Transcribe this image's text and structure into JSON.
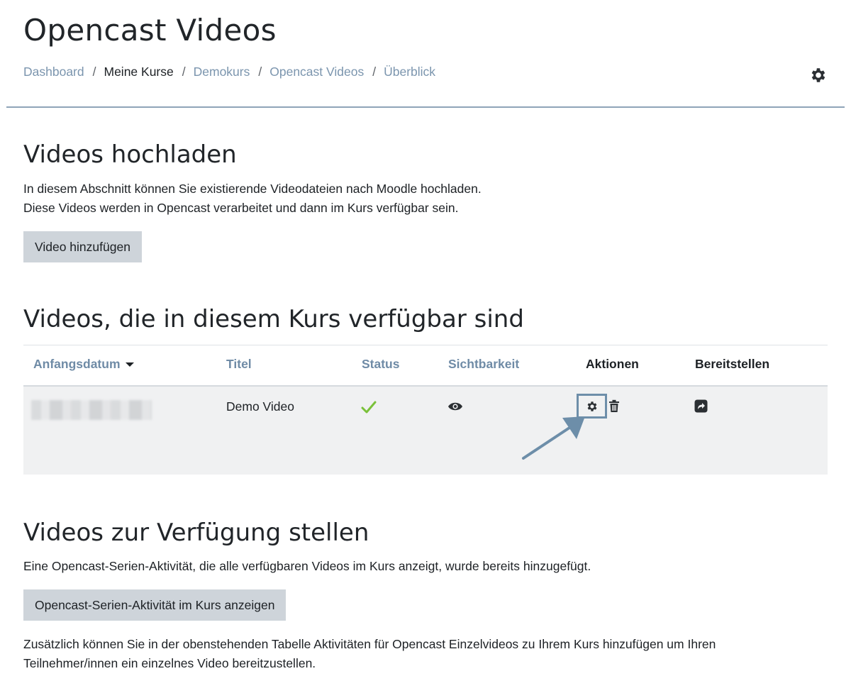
{
  "page": {
    "title": "Opencast Videos"
  },
  "breadcrumb": {
    "items": [
      "Dashboard",
      "Meine Kurse",
      "Demokurs",
      "Opencast Videos",
      "Überblick"
    ],
    "separator": "/"
  },
  "upload_section": {
    "heading": "Videos hochladen",
    "description_line1": "In diesem Abschnitt können Sie existierende Videodateien nach Moodle hochladen.",
    "description_line2": "Diese Videos werden in Opencast verarbeitet und dann im Kurs verfügbar sein.",
    "add_button": "Video hinzufügen"
  },
  "videos_section": {
    "heading": "Videos, die in diesem Kurs verfügbar sind",
    "columns": [
      "Anfangsdatum",
      "Titel",
      "Status",
      "Sichtbarkeit",
      "Aktionen",
      "Bereitstellen"
    ],
    "rows": [
      {
        "title": "Demo Video",
        "status_icon": "check-icon",
        "visibility_icon": "eye-icon",
        "actions": [
          "gear-icon",
          "trash-icon"
        ],
        "provide_icon": "share-icon"
      }
    ]
  },
  "provide_section": {
    "heading": "Videos zur Verfügung stellen",
    "description": "Eine Opencast-Serien-Aktivität, die alle verfügbaren Videos im Kurs anzeigt, wurde bereits hinzugefügt.",
    "show_button": "Opencast-Serien-Aktivität im Kurs anzeigen",
    "note_line1": "Zusätzlich können Sie in der obenstehenden Tabelle Aktivitäten für Opencast Einzelvideos zu Ihrem Kurs hinzufügen um Ihren",
    "note_line2": "Teilnehmer/innen ein einzelnes Video bereitzustellen."
  },
  "colors": {
    "link": "#7b95ae",
    "header_link": "#6f8ba6",
    "button_bg": "#ced4da",
    "row_bg": "#f0f1f2",
    "status_check": "#7ac13a",
    "highlight": "#6d8ea9"
  }
}
